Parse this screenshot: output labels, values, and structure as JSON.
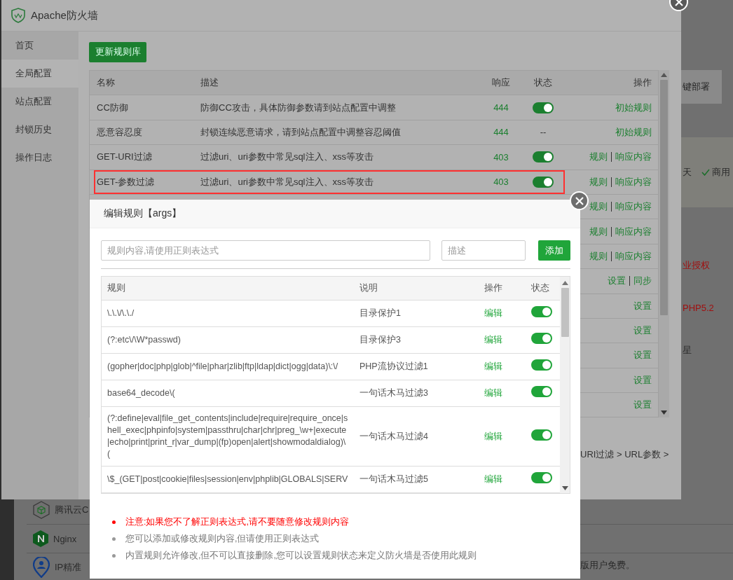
{
  "background": {
    "deploy_button": "键部署",
    "notice_text": "天",
    "notice_tag": "商用",
    "side_items": [
      {
        "text": "业授权",
        "kind": "warn"
      },
      {
        "text": "PHP5.2",
        "kind": "warn"
      },
      {
        "text": "星",
        "kind": "plain"
      }
    ],
    "plugins": [
      {
        "kind": "cube",
        "name": "腾讯云C"
      },
      {
        "kind": "hexagon",
        "name": "Nginx"
      },
      {
        "kind": "pin",
        "name": "IP精准"
      }
    ],
    "footer_note": "版用户免费。"
  },
  "window": {
    "title": "Apache防火墙",
    "sidebar": [
      {
        "label": "首页",
        "selected": false
      },
      {
        "label": "全局配置",
        "selected": true
      },
      {
        "label": "站点配置",
        "selected": false
      },
      {
        "label": "封锁历史",
        "selected": false
      },
      {
        "label": "操作日志",
        "selected": false
      }
    ],
    "update_button": "更新规则库",
    "table": {
      "columns": [
        "名称",
        "描述",
        "响应",
        "状态",
        "操作"
      ],
      "rows": [
        {
          "name": "CC防御",
          "description": "防御CC攻击，具体防御参数请到站点配置中调整",
          "code": "444",
          "status": {
            "kind": "switch",
            "on": true
          },
          "actions": [
            "初始规则"
          ],
          "highlighted": false
        },
        {
          "name": "恶意容忍度",
          "description": "封锁连续恶意请求，请到站点配置中调整容忍阈值",
          "code": "444",
          "status": {
            "kind": "text",
            "text": "--"
          },
          "actions": [
            "初始规则"
          ],
          "highlighted": false
        },
        {
          "name": "GET-URI过滤",
          "description": "过滤uri、uri参数中常见sql注入、xss等攻击",
          "code": "403",
          "status": {
            "kind": "switch",
            "on": true
          },
          "actions": [
            "规则",
            "响应内容"
          ],
          "highlighted": false
        },
        {
          "name": "GET-参数过滤",
          "description": "过滤uri、uri参数中常见sql注入、xss等攻击",
          "code": "403",
          "status": {
            "kind": "switch",
            "on": true
          },
          "actions": [
            "规则",
            "响应内容"
          ],
          "highlighted": true
        },
        {
          "actions": [
            "规则",
            "响应内容"
          ]
        },
        {
          "actions": [
            "规则",
            "响应内容"
          ]
        },
        {
          "actions": [
            "规则",
            "响应内容"
          ]
        },
        {
          "actions": [
            "设置",
            "同步"
          ]
        },
        {
          "actions": [
            "设置"
          ]
        },
        {
          "actions": [
            "设置"
          ]
        },
        {
          "actions": [
            "设置"
          ]
        },
        {
          "actions": [
            "设置"
          ]
        },
        {
          "actions": [
            "设置"
          ]
        }
      ]
    },
    "breadcrumb": "URI过滤 > URL参数 >"
  },
  "dialog": {
    "title": "编辑规则【args】",
    "rule_field": {
      "placeholder": "规则内容,请使用正则表达式"
    },
    "desc_field": {
      "placeholder": "描述"
    },
    "add_button": "添加",
    "columns": [
      "规则",
      "说明",
      "操作",
      "状态"
    ],
    "rules": [
      {
        "rule": "\\.\\.\\/\\.\\./",
        "description": "目录保护1",
        "action": "编辑",
        "on": true
      },
      {
        "rule": "(?:etc\\/\\W*passwd)",
        "description": "目录保护3",
        "action": "编辑",
        "on": true
      },
      {
        "rule": "(gopher|doc|php|glob|^file|phar|zlib|ftp|ldap|dict|ogg|data)\\:\\/",
        "description": "PHP流协议过滤1",
        "action": "编辑",
        "on": true
      },
      {
        "rule": "base64_decode\\(",
        "description": "一句话木马过滤3",
        "action": "编辑",
        "on": true
      },
      {
        "rule": "(?:define|eval|file_get_contents|include|require|require_once|shell_exec|phpinfo|system|passthru|char|chr|preg_\\w+|execute|echo|print|print_r|var_dump|(fp)open|alert|showmodaldialog)\\(",
        "description": "一句话木马过滤4",
        "action": "编辑",
        "on": true
      },
      {
        "rule": "\\$_(GET|post|cookie|files|session|env|phplib|GLOBALS|SERV",
        "description": "一句话木马过滤5",
        "action": "编辑",
        "on": true
      }
    ],
    "notes": [
      {
        "text": "注意:如果您不了解正则表达式,请不要随意修改规则内容",
        "kind": "warning"
      },
      {
        "text": "您可以添加或修改规则内容,但请使用正则表达式",
        "kind": "info"
      },
      {
        "text": "内置规则允许修改,但不可以直接删除,您可以设置规则状态来定义防火墙是否使用此规则",
        "kind": "info"
      }
    ]
  }
}
